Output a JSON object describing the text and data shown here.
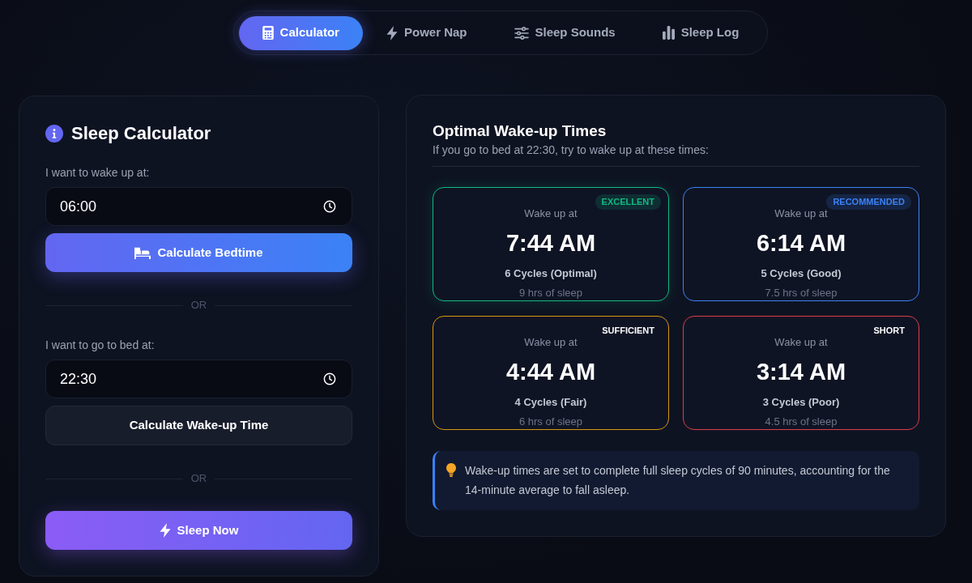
{
  "tabs": [
    {
      "label": "Calculator",
      "selected": true
    },
    {
      "label": "Power Nap",
      "selected": false
    },
    {
      "label": "Sleep Sounds",
      "selected": false
    },
    {
      "label": "Sleep Log",
      "selected": false
    }
  ],
  "calculator": {
    "title": "Sleep Calculator",
    "wake_label": "I want to wake up at:",
    "wake_time": {
      "value": "06:00"
    },
    "bedtime_button": "Calculate Bedtime",
    "or_1": "OR",
    "bed_label": "I want to go to bed at:",
    "bed_time": {
      "value": "22:30"
    },
    "wakeup_button": "Calculate Wake-up Time",
    "or_2": "OR",
    "sleep_now_button": "Sleep Now"
  },
  "results": {
    "title": "Optimal Wake-up Times",
    "subtitle": "If you go to bed at 22:30, try to wake up at these times:",
    "options": [
      {
        "badge": "EXCELLENT",
        "highlighted": true,
        "color": "#10b981",
        "label": "Wake up at",
        "time": "7:44 AM",
        "cycles": "6 Cycles (Optimal)",
        "duration": "9 hrs of sleep"
      },
      {
        "badge": "RECOMMENDED",
        "highlighted": true,
        "color": "#3b82f6",
        "label": "Wake up at",
        "time": "6:14 AM",
        "cycles": "5 Cycles (Good)",
        "duration": "7.5 hrs of sleep"
      },
      {
        "badge": "SUFFICIENT",
        "highlighted": false,
        "color": "#d9960f",
        "label": "Wake up at",
        "time": "4:44 AM",
        "cycles": "4 Cycles (Fair)",
        "duration": "6 hrs of sleep"
      },
      {
        "badge": "SHORT",
        "highlighted": false,
        "color": "#dc3f4a",
        "label": "Wake up at",
        "time": "3:14 AM",
        "cycles": "3 Cycles (Poor)",
        "duration": "4.5 hrs of sleep"
      }
    ],
    "tip": "Wake-up times are set to complete full sleep cycles of 90 minutes, accounting for the 14-minute average to fall asleep."
  }
}
